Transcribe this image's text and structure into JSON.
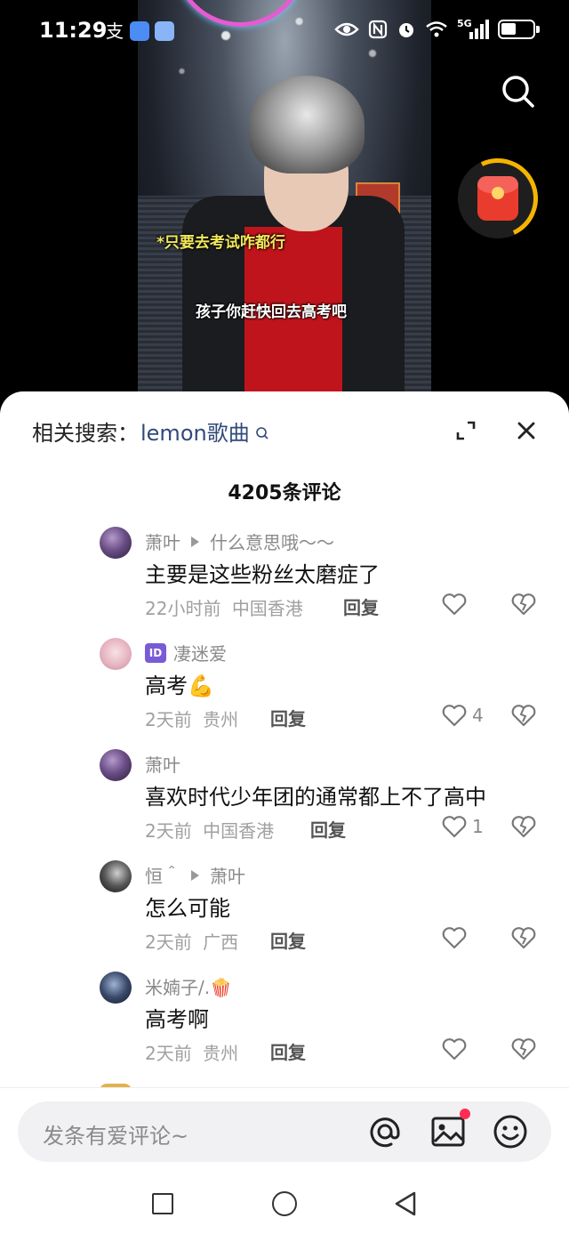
{
  "status_bar": {
    "time": "11:29",
    "alipay_glyph": "支",
    "network": "5G",
    "icons": [
      "alipay-icon",
      "browser-icon",
      "app-icon",
      "eye-icon",
      "nfc-icon",
      "alarm-icon",
      "wifi-icon",
      "signal-icon",
      "battery-icon"
    ]
  },
  "video": {
    "caption_top": "*只要去考试咋都行",
    "caption_bottom": "孩子你赶快回去高考吧"
  },
  "sheet": {
    "related_label": "相关搜索：",
    "related_term": "lemon歌曲",
    "comment_count_title": "4205条评论",
    "comments": [
      {
        "user": "萧叶",
        "reply_to": "什么意思哦～～",
        "text": "主要是这些粉丝太磨症了",
        "time": "22小时前",
        "location": "中国香港",
        "reply_label": "回复",
        "likes": ""
      },
      {
        "badge": "ID",
        "user": "凄迷爱",
        "text": "高考💪",
        "time": "2天前",
        "location": "贵州",
        "reply_label": "回复",
        "likes": "4"
      },
      {
        "user": "萧叶",
        "text": "喜欢时代少年团的通常都上不了高中",
        "time": "2天前",
        "location": "中国香港",
        "reply_label": "回复",
        "likes": "1"
      },
      {
        "user": "恒＾",
        "reply_to": "萧叶",
        "text": "怎么可能",
        "time": "2天前",
        "location": "广西",
        "reply_label": "回复",
        "likes": ""
      },
      {
        "user": "米婻子/.🍿",
        "text": "高考啊",
        "time": "2天前",
        "location": "贵州",
        "reply_label": "回复",
        "likes": ""
      }
    ]
  },
  "input": {
    "placeholder": "发条有爱评论~"
  },
  "colors": {
    "accent_red": "#fe2c55",
    "link_blue": "#304a7a",
    "redpacket": "#ea3c2e",
    "ring_gold": "#f5b400"
  }
}
